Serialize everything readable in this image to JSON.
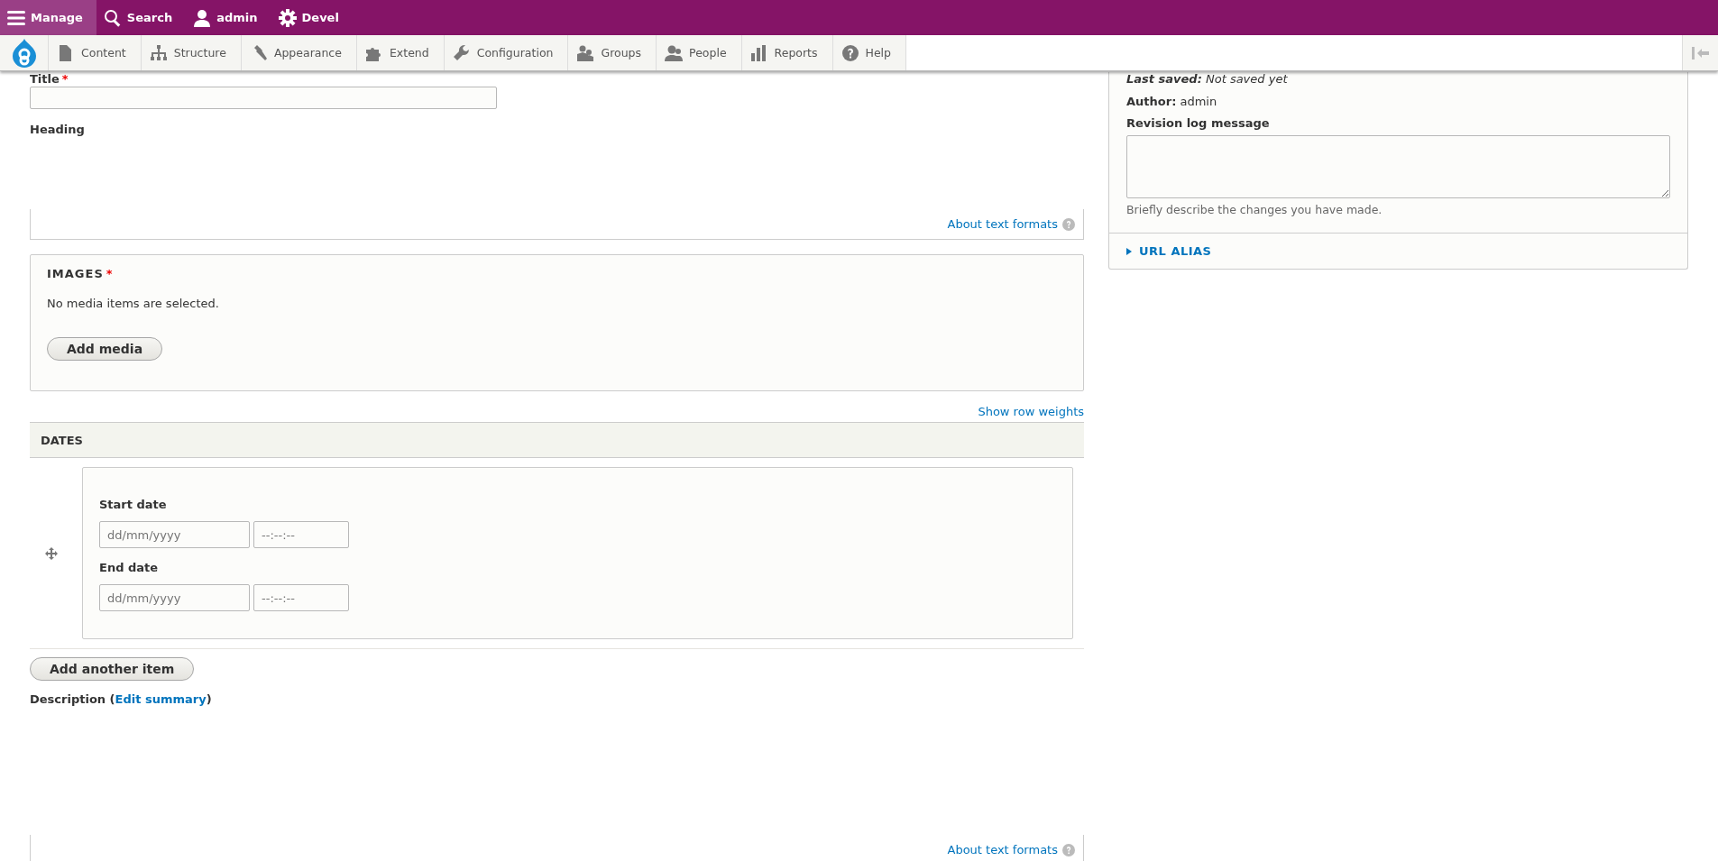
{
  "toolbar": {
    "items": [
      {
        "label": "Manage",
        "selected": true
      },
      {
        "label": "Search",
        "selected": false
      },
      {
        "label": "admin",
        "selected": false
      },
      {
        "label": "Devel",
        "selected": false
      }
    ]
  },
  "tray": {
    "items": [
      {
        "label": "Content"
      },
      {
        "label": "Structure"
      },
      {
        "label": "Appearance"
      },
      {
        "label": "Extend"
      },
      {
        "label": "Configuration"
      },
      {
        "label": "Groups"
      },
      {
        "label": "People"
      },
      {
        "label": "Reports"
      },
      {
        "label": "Help"
      }
    ]
  },
  "form": {
    "title_field": {
      "label": "Title",
      "required_mark": "*"
    },
    "heading_field": {
      "label": "Heading",
      "format_link": "About text formats"
    },
    "images": {
      "legend": "IMAGES",
      "required_mark": "*",
      "message": "No media items are selected.",
      "button": "Add media"
    },
    "show_row_weights": "Show row weights",
    "dates": {
      "header": "DATES",
      "rows": [
        {
          "fields": [
            {
              "label": "Start date",
              "date_placeholder": "dd/mm/yyyy",
              "time_placeholder": "--:--:--"
            },
            {
              "label": "End date",
              "date_placeholder": "dd/mm/yyyy",
              "time_placeholder": "--:--:--"
            }
          ]
        }
      ],
      "add_button": "Add another item"
    },
    "description": {
      "prefix": "Description (",
      "link": "Edit summary",
      "suffix": ")",
      "format_link": "About text formats"
    }
  },
  "sidebar": {
    "last_saved": "**Last saved:** Not saved yet",
    "author": "**Author:** admin",
    "revision_label": "Revision log message",
    "revision_help": "Briefly describe the changes you have made.",
    "url_alias": {
      "label": "URL ALIAS",
      "expanded": false
    }
  }
}
